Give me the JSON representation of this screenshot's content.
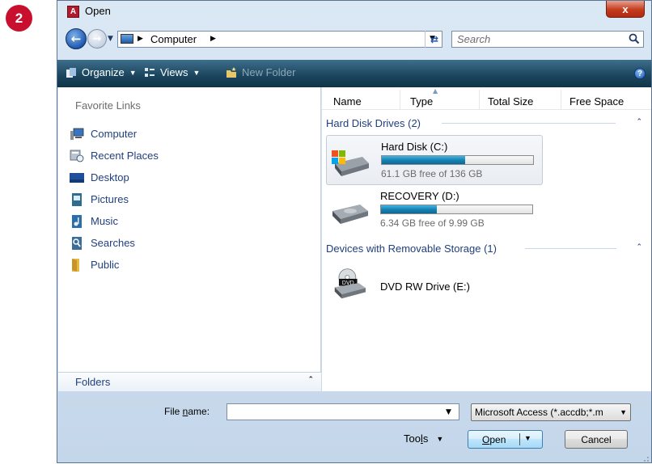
{
  "step_badge": "2",
  "window": {
    "title": "Open",
    "app_icon_letter": "A",
    "close_glyph": "x"
  },
  "navbar": {
    "address_location": "Computer",
    "search_placeholder": "Search"
  },
  "toolbar": {
    "organize_label": "Organize",
    "views_label": "Views",
    "new_folder_label": "New Folder",
    "help_glyph": "?"
  },
  "favorites": {
    "heading": "Favorite Links",
    "items": [
      {
        "label": "Computer",
        "icon": "computer-icon"
      },
      {
        "label": "Recent Places",
        "icon": "recent-places-icon"
      },
      {
        "label": "Desktop",
        "icon": "desktop-icon"
      },
      {
        "label": "Pictures",
        "icon": "pictures-icon"
      },
      {
        "label": "Music",
        "icon": "music-icon"
      },
      {
        "label": "Searches",
        "icon": "searches-icon"
      },
      {
        "label": "Public",
        "icon": "public-folder-icon"
      }
    ],
    "folders_label": "Folders"
  },
  "columns": [
    "Name",
    "Type",
    "Total Size",
    "Free Space"
  ],
  "groups": [
    {
      "label": "Hard Disk Drives (2)",
      "drives": [
        {
          "name": "Hard Disk (C:)",
          "free_text": "61.1 GB free of 136 GB",
          "used_fraction": 0.55,
          "selected": true
        },
        {
          "name": "RECOVERY (D:)",
          "free_text": "6.34 GB free of 9.99 GB",
          "used_fraction": 0.37,
          "selected": false
        }
      ]
    },
    {
      "label": "Devices with Removable Storage (1)",
      "drives": [
        {
          "name": "DVD RW Drive (E:)",
          "dvd_badge": "DVD"
        }
      ]
    }
  ],
  "bottom": {
    "file_name_label_pre": "File ",
    "file_name_label_underlined": "n",
    "file_name_label_post": "ame:",
    "file_name_value": "",
    "file_type_value": "Microsoft Access (*.accdb;*.m",
    "tools_label_pre": "Too",
    "tools_label_underlined": "l",
    "tools_label_post": "s",
    "open_label_underlined": "O",
    "open_label_rest": "pen",
    "cancel_label": "Cancel"
  }
}
